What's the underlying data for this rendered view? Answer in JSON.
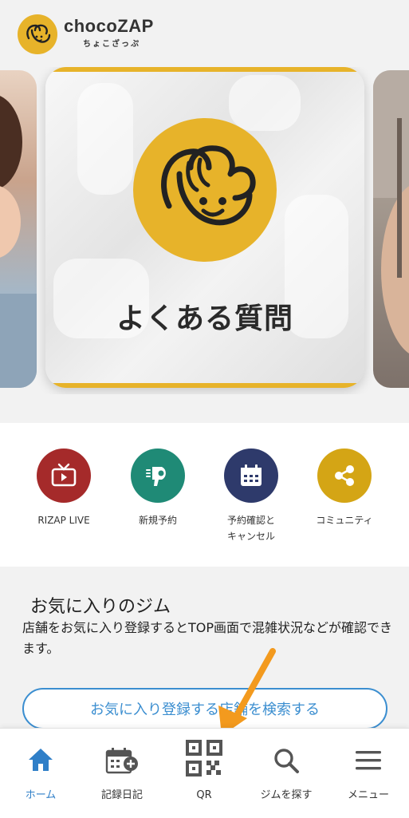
{
  "header": {
    "logo_text": "chocoZAP",
    "logo_sub": "ちょこざっぷ"
  },
  "carousel": {
    "card_title": "よくある質問"
  },
  "shortcuts": [
    {
      "label": "RIZAP LIVE",
      "icon": "tv-icon",
      "color": "#a52a2a"
    },
    {
      "label": "新規予約",
      "icon": "dryer-icon",
      "color": "#1f8a76"
    },
    {
      "label": "予約確認と\nキャンセル",
      "icon": "calendar-icon",
      "color": "#2e3a6b"
    },
    {
      "label": "コミュニティ",
      "icon": "share-icon",
      "color": "#d4a515"
    }
  ],
  "favorites": {
    "title": "お気に入りのジム",
    "description": "店舗をお気に入り登録するとTOP画面で混雑状況などが確認できます。",
    "button_label": "お気に入り登録する店舗を検索する"
  },
  "tabbar": {
    "tabs": [
      {
        "label": "ホーム",
        "icon": "home-icon",
        "active": true
      },
      {
        "label": "記録日記",
        "icon": "calendar-add-icon",
        "active": false
      },
      {
        "label": "QR",
        "icon": "qr-code-icon",
        "active": false
      },
      {
        "label": "ジムを探す",
        "icon": "search-icon",
        "active": false
      },
      {
        "label": "メニュー",
        "icon": "menu-icon",
        "active": false
      }
    ]
  },
  "colors": {
    "brand_yellow": "#e7b32a",
    "active_blue": "#2f7fc8",
    "arrow_orange": "#f39a1e"
  }
}
